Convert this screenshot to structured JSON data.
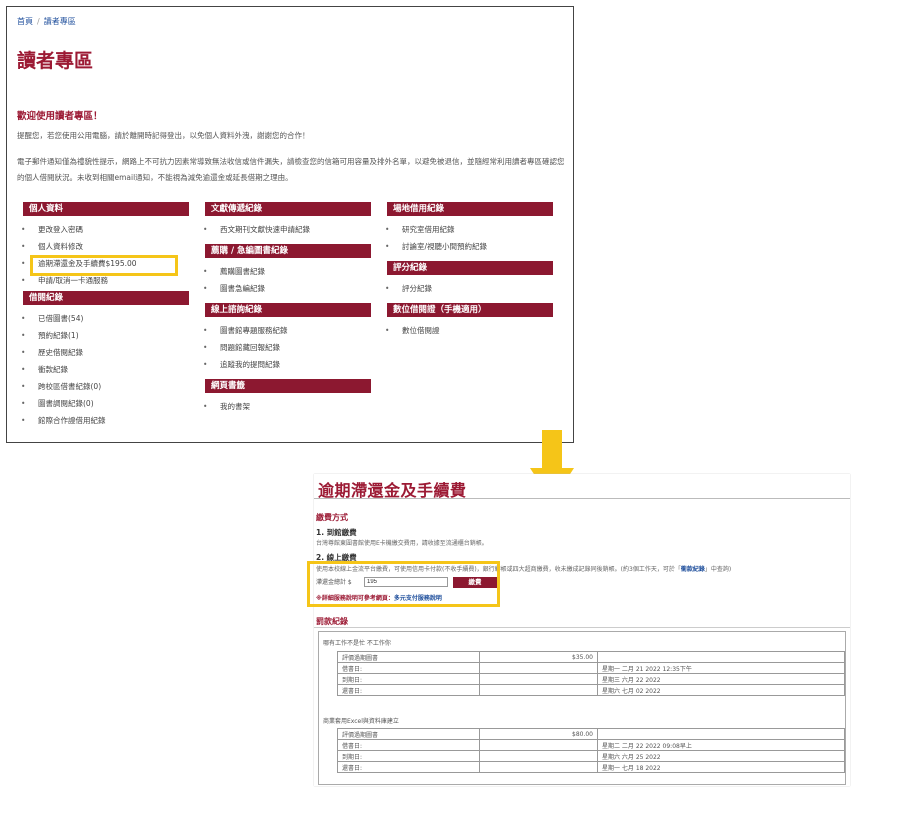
{
  "breadcrumb": {
    "home": "首頁",
    "current": "讀者專區"
  },
  "page_title": "讀者專區",
  "welcome": "歡迎使用讀者專區！",
  "notice1": "提醒您，若您使用公用電腦，請於離開時記得登出，以免個人資料外洩，謝謝您的合作！",
  "notice2": "電子郵件通知僅為禮貌性提示，網路上不可抗力因素常導致無法收信或信件漏失，請檢查您的信箱可用容量及排外名單，以避免被退信，並隨經常利用讀者專區確認您的個人借閱狀況。未收到相關email通知，不能視為減免逾還金或延長借期之理由。",
  "columns": [
    {
      "sections": [
        {
          "title": "個人資料",
          "items": [
            "更改登入密碼",
            "個人資料修改",
            "逾期滯還金及手續費$195.00",
            "申請/取消一卡通服務"
          ]
        },
        {
          "title": "借閱紀錄",
          "items": [
            "已借圖書(54)",
            "預約紀錄(1)",
            "歷史借閱紀錄",
            "衝款紀錄",
            "跨校區借書紀錄(0)",
            "圖書調閱紀錄(0)",
            "館際合作證借用紀錄"
          ]
        }
      ]
    },
    {
      "sections": [
        {
          "title": "文獻傳遞紀錄",
          "items": [
            "西文期刊文獻快速申請紀錄"
          ]
        },
        {
          "title": "薦購 / 急編圖書紀錄",
          "items": [
            "薦購圖書紀錄",
            "圖書急編紀錄"
          ]
        },
        {
          "title": "線上諮詢紀錄",
          "items": [
            "圖書館專題服務紀錄",
            "問題館藏回報紀錄",
            "追蹤我的提問紀錄"
          ]
        },
        {
          "title": "網頁書籤",
          "items": [
            "我的書架"
          ]
        }
      ]
    },
    {
      "sections": [
        {
          "title": "場地借用紀錄",
          "items": [
            "研究室借用紀錄",
            "討論室/視聽小間預約紀錄"
          ]
        },
        {
          "title": "評分紀錄",
          "items": [
            "評分紀錄"
          ]
        },
        {
          "title": "數位借閱證（手機適用）",
          "items": [
            "數位借閱證"
          ]
        }
      ]
    }
  ],
  "fees": {
    "title": "逾期滯還金及手續費",
    "payment_heading": "繳費方式",
    "method1_title": "1. 到館繳費",
    "method1_desc": "台灣尊館東圍書館使用E卡機繳交費用，請收據至流通櫃台銷帳。",
    "method2_title": "2. 線上繳費",
    "method2_desc_pre": "使用本校線上金流平台繳費，可使用信用卡付款(不收手續費)，銀行轉帳或四大超商繳費，收未繳成記錄同後銷帳。(約3個工作天，可於「",
    "method2_desc_link": "衝款紀錄",
    "method2_desc_post": "」中查詢)",
    "amount_label": "滯還金總計 $",
    "amount_value": "195",
    "pay_button": "繳費",
    "detail_link_pre": "※詳細服務說明可參考網頁：",
    "detail_link": "多元支付服務說明"
  },
  "fines": {
    "heading": "罰款紀錄",
    "records": [
      {
        "title": "哪有工作不是忙 不工作你",
        "rows": [
          [
            "評價過期圖書",
            "",
            "$35.00",
            ""
          ],
          [
            "借書日:",
            "",
            "",
            "星期一 二月 21 2022 12:35下午"
          ],
          [
            "到期日:",
            "",
            "",
            "星期三 六月 22 2022"
          ],
          [
            "還書日:",
            "",
            "",
            "星期六 七月 02 2022"
          ]
        ]
      },
      {
        "title": "商業套用Excel與資料庫建立",
        "rows": [
          [
            "評價過期圖書",
            "",
            "$80.00",
            ""
          ],
          [
            "借書日:",
            "",
            "",
            "星期二 二月 22 2022 09:08早上"
          ],
          [
            "到期日:",
            "",
            "",
            "星期六 六月 25 2022"
          ],
          [
            "還書日:",
            "",
            "",
            "星期一 七月 18 2022"
          ]
        ]
      }
    ]
  },
  "colors": {
    "accent": "#8c1830",
    "highlight": "#f5c518",
    "link": "#1f4f9c"
  }
}
